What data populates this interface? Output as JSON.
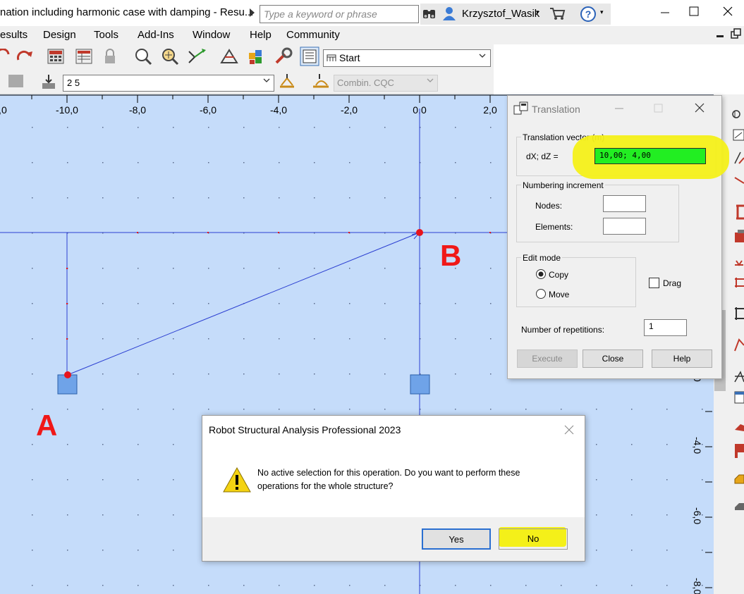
{
  "window": {
    "title": "nation including harmonic case with damping - Resu...",
    "search_placeholder": "Type a keyword or phrase",
    "user_name": "Krzysztof_Wasik",
    "user_caret": "▾",
    "help_caret": "▾",
    "help_symbol": "?",
    "minimize": "—",
    "maximize": "☐",
    "close": "✕"
  },
  "menu": {
    "items": [
      "esults",
      "Design",
      "Tools",
      "Add-Ins",
      "Window",
      "Help",
      "Community"
    ]
  },
  "toolbar": {
    "view_combo": "Start",
    "case_combo": "2 5",
    "combination_combo": "Combin. CQC"
  },
  "canvas": {
    "x_ticks": [
      "0,0",
      "-10,0",
      "-8,0",
      "-6,0",
      "-4,0",
      "-2,0",
      "0,0",
      "2,0"
    ],
    "y_ticks": [
      "0",
      "-4,0",
      "-6,0",
      "-8,0"
    ],
    "annotations": {
      "a": "A",
      "b": "B"
    }
  },
  "translation_dialog": {
    "title": "Translation",
    "vector_group": "Translation vector (m)",
    "vector_label": "dX; dZ  =",
    "vector_value": "10,00; 4,00",
    "numbering_group": "Numbering increment",
    "nodes_label": "Nodes:",
    "nodes_value": "",
    "elements_label": "Elements:",
    "elements_value": "",
    "edit_mode_group": "Edit mode",
    "copy_label": "Copy",
    "move_label": "Move",
    "drag_label": "Drag",
    "edit_mode_selected": "Copy",
    "drag_checked": false,
    "repetitions_label": "Number of repetitions:",
    "repetitions_value": "1",
    "execute_button": "Execute",
    "close_button": "Close",
    "help_button": "Help"
  },
  "message_box": {
    "title": "Robot Structural Analysis Professional 2023",
    "close": "✕",
    "message_line1": "No active selection for this operation. Do you want to perform these",
    "message_line2": "operations for the whole structure?",
    "yes_button": "Yes",
    "no_button": "No"
  },
  "colors": {
    "canvas_bg": "#c5dcfa",
    "grid_line": "#2b3fd1",
    "node_red": "#e8141c",
    "support_fill": "#6fa3e8",
    "highlight_yellow": "#f4f019",
    "value_green": "#22ee22",
    "annotation_red": "#f01818"
  }
}
